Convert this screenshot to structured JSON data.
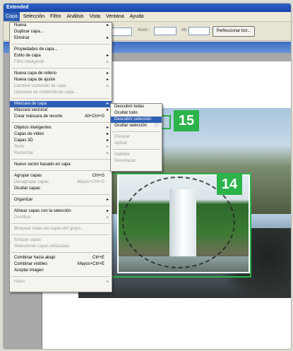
{
  "window": {
    "title": "Extended"
  },
  "menubar": [
    "Capa",
    "Selección",
    "Filtro",
    "Análisis",
    "Vista",
    "Ventana",
    "Ayuda"
  ],
  "options": {
    "anch_label": "Anch.:",
    "alt_label": "Alt.:",
    "button_label": "Perfeccionar bor..."
  },
  "menu": {
    "group1": [
      {
        "label": "Nueva",
        "arrow": true,
        "disabled": false
      },
      {
        "label": "Duplicar capa...",
        "disabled": false
      },
      {
        "label": "Eliminar",
        "arrow": true,
        "disabled": false
      }
    ],
    "group2": [
      {
        "label": "Propiedades de capa...",
        "disabled": false
      },
      {
        "label": "Estilo de capa",
        "arrow": true,
        "disabled": false
      },
      {
        "label": "Filtro inteligente",
        "arrow": true,
        "disabled": true
      }
    ],
    "group3": [
      {
        "label": "Nueva capa de relleno",
        "arrow": true,
        "disabled": false
      },
      {
        "label": "Nueva capa de ajuste",
        "arrow": true,
        "disabled": false
      },
      {
        "label": "Cambiar contenido de capa",
        "arrow": true,
        "disabled": true
      },
      {
        "label": "Opciones de contenido de capa...",
        "disabled": true
      }
    ],
    "group4": [
      {
        "label": "Máscara de capa",
        "arrow": true,
        "highlighted": true
      },
      {
        "label": "Máscara vectorial",
        "arrow": true,
        "disabled": false
      },
      {
        "label": "Crear máscara de recorte",
        "shortcut": "Alt+Ctrl+G",
        "disabled": false
      }
    ],
    "group5": [
      {
        "label": "Objetos inteligentes",
        "arrow": true,
        "disabled": false
      },
      {
        "label": "Capas de vídeo",
        "arrow": true,
        "disabled": false
      },
      {
        "label": "Capas 3D",
        "arrow": true,
        "disabled": false
      },
      {
        "label": "Texto",
        "arrow": true,
        "disabled": true
      },
      {
        "label": "Rasterizar",
        "arrow": true,
        "disabled": true
      }
    ],
    "group6": [
      {
        "label": "Nuevo sector basado en capa",
        "disabled": false
      }
    ],
    "group7": [
      {
        "label": "Agrupar capas",
        "shortcut": "Ctrl+G",
        "disabled": false
      },
      {
        "label": "Desagrupar capas",
        "shortcut": "Mayús+Ctrl+G",
        "disabled": true
      },
      {
        "label": "Ocultar capas",
        "disabled": false
      }
    ],
    "group8": [
      {
        "label": "Organizar",
        "arrow": true,
        "disabled": false
      }
    ],
    "group9": [
      {
        "label": "Alinear capas con la selección",
        "arrow": true,
        "disabled": false
      },
      {
        "label": "Distribuir",
        "arrow": true,
        "disabled": true
      }
    ],
    "group10": [
      {
        "label": "Bloquear todas las capas del grupo...",
        "disabled": true
      }
    ],
    "group11": [
      {
        "label": "Enlazar capas",
        "disabled": true
      },
      {
        "label": "Seleccionar capas enlazadas",
        "disabled": true
      }
    ],
    "group12": [
      {
        "label": "Combinar hacia abajo",
        "shortcut": "Ctrl+E",
        "disabled": false
      },
      {
        "label": "Combinar visibles",
        "shortcut": "Mayús+Ctrl+E",
        "disabled": false
      },
      {
        "label": "Acoplar imagen",
        "disabled": false
      }
    ],
    "group13": [
      {
        "label": "Halos",
        "arrow": true,
        "disabled": true
      }
    ]
  },
  "submenu": [
    {
      "label": "Descubrir todas",
      "disabled": false
    },
    {
      "label": "Ocultar todo",
      "disabled": false
    },
    {
      "label": "Descubrir selección",
      "highlighted": true
    },
    {
      "label": "Ocultar selección",
      "disabled": false
    },
    {
      "sep": true
    },
    {
      "label": "Eliminar",
      "disabled": true
    },
    {
      "label": "Aplicar",
      "disabled": true
    },
    {
      "sep": true
    },
    {
      "label": "Habilitar",
      "disabled": true
    },
    {
      "label": "Desenlazar",
      "disabled": true
    }
  ],
  "badges": {
    "step_15": "15",
    "step_14": "14"
  },
  "colors": {
    "accent_green": "#2cb34a",
    "menu_highlight": "#2f5fb5"
  }
}
